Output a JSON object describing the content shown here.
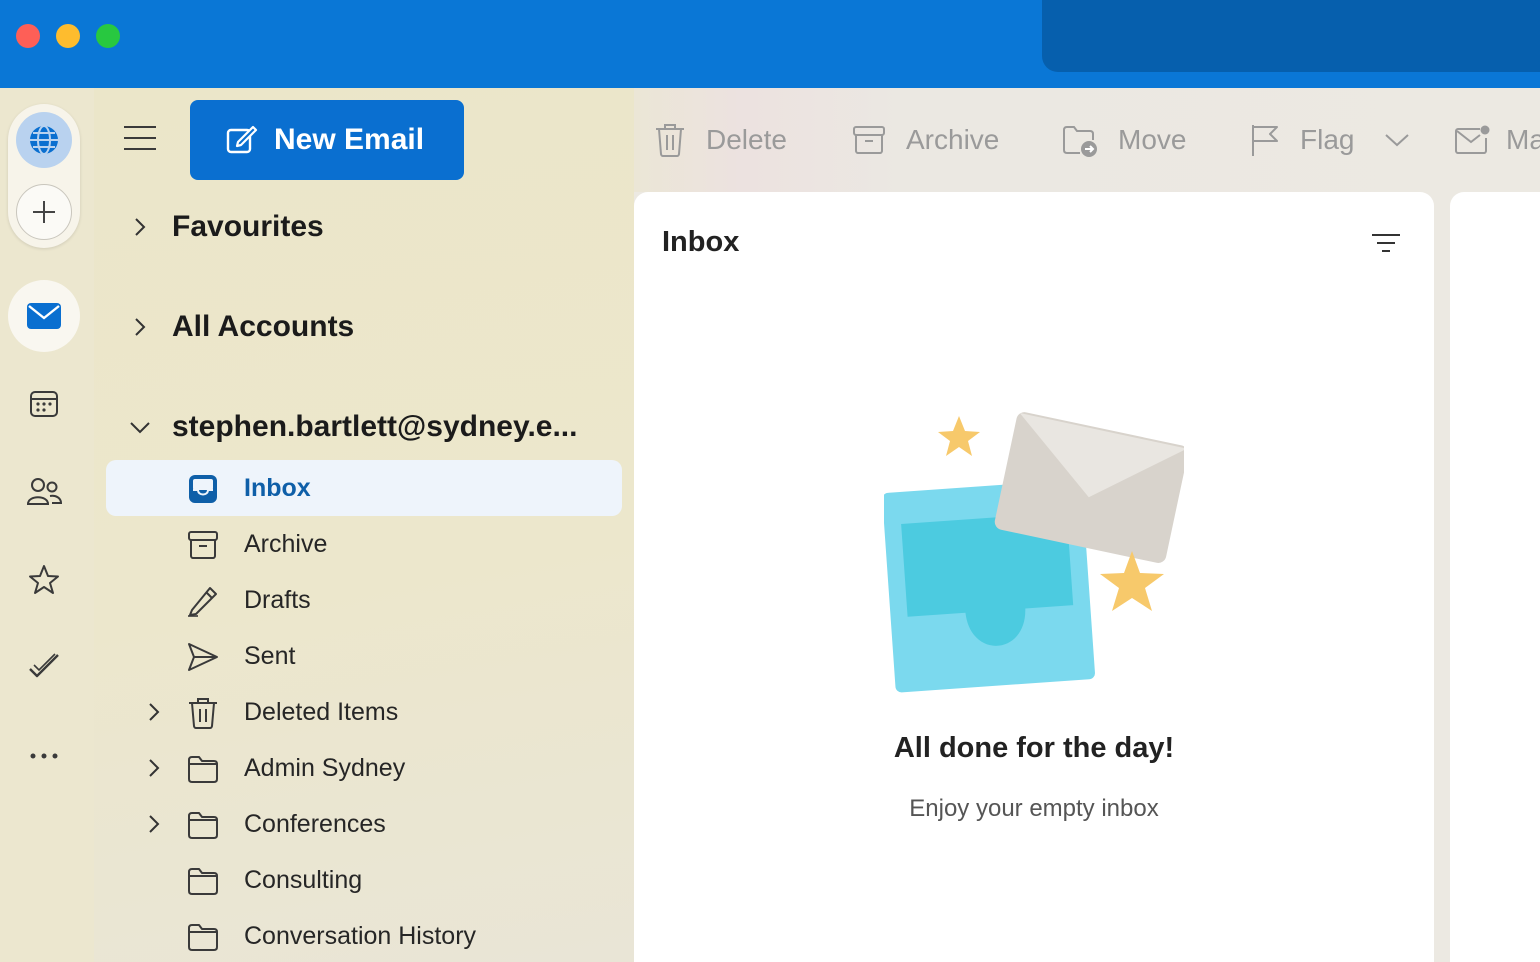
{
  "toolbar": {
    "new_email_label": "New Email"
  },
  "nav": {
    "favourites": "Favourites",
    "all_accounts": "All Accounts",
    "account": "stephen.bartlett@sydney.e..."
  },
  "folders": [
    {
      "label": "Inbox",
      "icon": "inbox-icon",
      "selected": true,
      "expandable": false
    },
    {
      "label": "Archive",
      "icon": "archive-icon",
      "selected": false,
      "expandable": false
    },
    {
      "label": "Drafts",
      "icon": "pencil-icon",
      "selected": false,
      "expandable": false
    },
    {
      "label": "Sent",
      "icon": "send-icon",
      "selected": false,
      "expandable": false
    },
    {
      "label": "Deleted Items",
      "icon": "trash-icon",
      "selected": false,
      "expandable": true
    },
    {
      "label": "Admin Sydney",
      "icon": "folder-icon",
      "selected": false,
      "expandable": true
    },
    {
      "label": "Conferences",
      "icon": "folder-icon",
      "selected": false,
      "expandable": true
    },
    {
      "label": "Consulting",
      "icon": "folder-icon",
      "selected": false,
      "expandable": false
    },
    {
      "label": "Conversation History",
      "icon": "folder-icon",
      "selected": false,
      "expandable": false
    }
  ],
  "commands": {
    "delete": "Delete",
    "archive": "Archive",
    "move": "Move",
    "flag": "Flag",
    "mark": "Ma"
  },
  "message_list": {
    "title": "Inbox",
    "empty_title": "All done for the day!",
    "empty_subtitle": "Enjoy your empty inbox"
  },
  "colors": {
    "accent": "#0a6fd0",
    "titlebar": "#0a77d6",
    "selected_text": "#0f5fa8"
  }
}
